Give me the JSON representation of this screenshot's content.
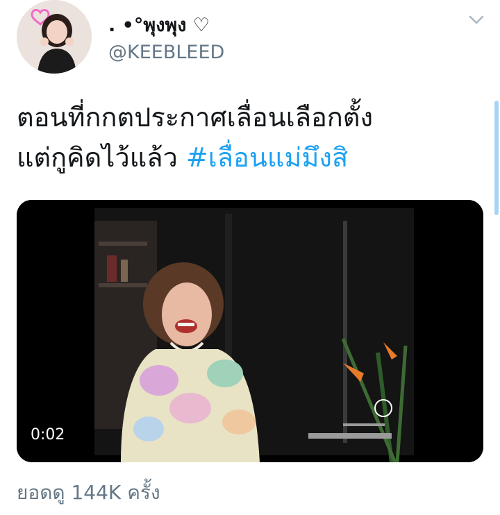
{
  "user": {
    "display_name": ". •°พุงพุง ♡",
    "handle": "@KEEBLEED"
  },
  "tweet": {
    "text_line1": "ตอนที่กกตประกาศเลื่อนเลือกตั้ง",
    "text_line2": "แต่กูคิดไว้แล้ว ",
    "hashtag": "#เลื่อนแม่มึงสิ"
  },
  "media": {
    "duration": "0:02"
  },
  "stats": {
    "views": "ยอดดู 144K ครั้ง"
  },
  "icons": {
    "menu": "chevron-down-icon"
  },
  "colors": {
    "hashtag": "#1da1f2",
    "secondary_text": "#657786",
    "primary_text": "#14171a"
  }
}
